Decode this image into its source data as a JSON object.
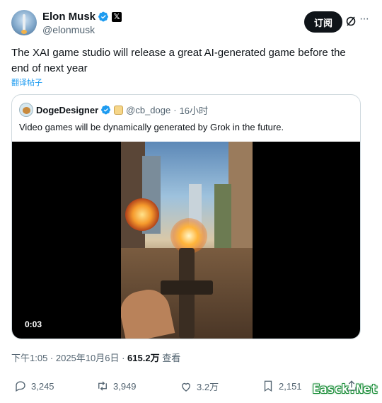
{
  "author": {
    "name": "Elon Musk",
    "handle": "@elonmusk",
    "x_badge": "𝕏"
  },
  "header": {
    "subscribe_label": "订阅"
  },
  "tweet": {
    "text": "The XAI game studio will release a great AI-generated game before the end of next year",
    "translate_label": "翻译帖子"
  },
  "quote": {
    "name": "DogeDesigner",
    "handle": "@cb_doge",
    "separator": "·",
    "time": "16小时",
    "text": "Video games will be dynamically generated by Grok in the future.",
    "video_duration": "0:03"
  },
  "meta": {
    "timestamp": "下午1:05 · 2025年10月6日 · ",
    "views": "615.2万",
    "views_label": " 查看"
  },
  "actions": {
    "replies": "3,245",
    "reposts": "3,949",
    "likes": "3.2万",
    "bookmarks": "2,151"
  },
  "watermark": "Easck.Net",
  "colors": {
    "accent": "#1d9bf0",
    "text": "#0f1419",
    "secondary": "#536471",
    "border": "#cfd9de"
  },
  "icons": [
    "verified-badge-icon",
    "x-logo-icon",
    "grok-icon",
    "more-icon",
    "reply-icon",
    "repost-icon",
    "like-icon",
    "bookmark-icon",
    "share-icon"
  ]
}
